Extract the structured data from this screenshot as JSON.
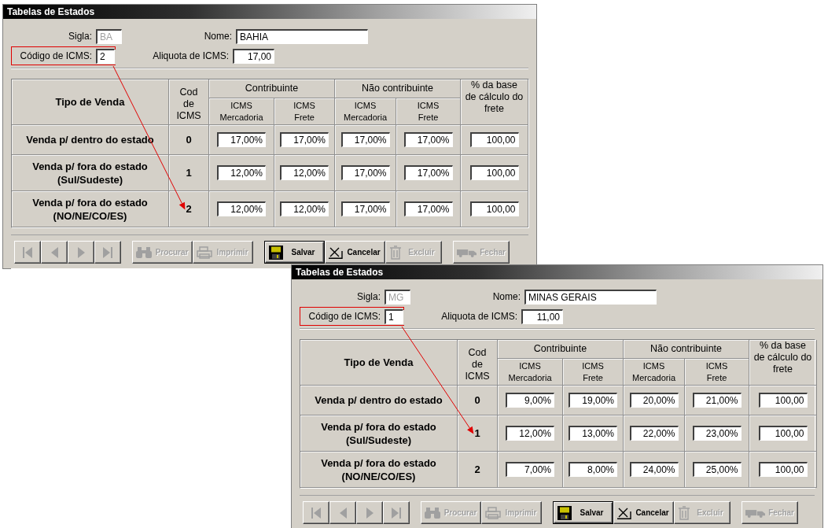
{
  "windows": [
    {
      "title": "Tabelas de Estados",
      "fields": {
        "sigla": {
          "label": "Sigla:",
          "value": "BA",
          "disabled": true
        },
        "nome": {
          "label": "Nome:",
          "value": "BAHIA"
        },
        "codigo": {
          "label": "Código de ICMS:",
          "value": "2",
          "highlighted": true
        },
        "aliquota": {
          "label": "Aliquota de ICMS:",
          "value": "17,00"
        }
      },
      "table": {
        "columns": [
          {
            "label": "Tipo de Venda"
          },
          {
            "label": "Cod de ICMS"
          },
          {
            "label": "Contribuinte",
            "sub": [
              "ICMS Mercadoria",
              "ICMS Frete"
            ]
          },
          {
            "label": "Não contribuinte",
            "sub": [
              "ICMS Mercadoria",
              "ICMS Frete"
            ]
          },
          {
            "label": "% da base de cálculo do frete"
          }
        ],
        "rows": [
          {
            "tipo": "Venda p/ dentro do estado",
            "cod": "0",
            "values": [
              "17,00%",
              "17,00%",
              "17,00%",
              "17,00%",
              "100,00"
            ],
            "pointed": false
          },
          {
            "tipo": "Venda p/ fora do estado (Sul/Sudeste)",
            "cod": "1",
            "values": [
              "12,00%",
              "12,00%",
              "17,00%",
              "17,00%",
              "100,00"
            ],
            "pointed": false
          },
          {
            "tipo": "Venda p/ fora do estado (NO/NE/CO/ES)",
            "cod": "2",
            "values": [
              "12,00%",
              "12,00%",
              "17,00%",
              "17,00%",
              "100,00"
            ],
            "pointed": true
          }
        ]
      },
      "toolbar": [
        {
          "buttons": [
            {
              "kind": "first",
              "disabled": true
            },
            {
              "kind": "prev",
              "disabled": true
            },
            {
              "kind": "next",
              "disabled": true
            },
            {
              "kind": "last",
              "disabled": true
            }
          ]
        },
        {
          "buttons": [
            {
              "kind": "search",
              "label": "Procurar",
              "disabled": true
            },
            {
              "kind": "print",
              "label": "Imprimir",
              "disabled": true
            }
          ]
        },
        {
          "buttons": [
            {
              "kind": "save",
              "label": "Salvar",
              "disabled": false,
              "default": true
            },
            {
              "kind": "cancel",
              "label": "Cancelar",
              "disabled": false,
              "default": false
            },
            {
              "kind": "delete",
              "label": "Excluir",
              "disabled": true
            }
          ]
        },
        {
          "buttons": [
            {
              "kind": "close",
              "label": "Fechar",
              "disabled": true
            }
          ]
        }
      ]
    },
    {
      "title": "Tabelas de Estados",
      "fields": {
        "sigla": {
          "label": "Sigla:",
          "value": "MG",
          "disabled": true
        },
        "nome": {
          "label": "Nome:",
          "value": "MINAS GERAIS"
        },
        "codigo": {
          "label": "Código de ICMS:",
          "value": "1",
          "highlighted": true
        },
        "aliquota": {
          "label": "Aliquota de ICMS:",
          "value": "11,00"
        }
      },
      "table": {
        "columns": [
          {
            "label": "Tipo de Venda"
          },
          {
            "label": "Cod de ICMS"
          },
          {
            "label": "Contribuinte",
            "sub": [
              "ICMS Mercadoria",
              "ICMS Frete"
            ]
          },
          {
            "label": "Não contribuinte",
            "sub": [
              "ICMS Mercadoria",
              "ICMS Frete"
            ]
          },
          {
            "label": "% da base de cálculo do frete"
          }
        ],
        "rows": [
          {
            "tipo": "Venda p/ dentro do estado",
            "cod": "0",
            "values": [
              "9,00%",
              "19,00%",
              "20,00%",
              "21,00%",
              "100,00"
            ],
            "pointed": false
          },
          {
            "tipo": "Venda p/ fora do estado (Sul/Sudeste)",
            "cod": "1",
            "values": [
              "12,00%",
              "13,00%",
              "22,00%",
              "23,00%",
              "100,00"
            ],
            "pointed": true
          },
          {
            "tipo": "Venda p/ fora do estado (NO/NE/CO/ES)",
            "cod": "2",
            "values": [
              "7,00%",
              "8,00%",
              "24,00%",
              "25,00%",
              "100,00"
            ],
            "pointed": false
          }
        ]
      },
      "toolbar": [
        {
          "buttons": [
            {
              "kind": "first",
              "disabled": true
            },
            {
              "kind": "prev",
              "disabled": true
            },
            {
              "kind": "next",
              "disabled": true
            },
            {
              "kind": "last",
              "disabled": true
            }
          ]
        },
        {
          "buttons": [
            {
              "kind": "search",
              "label": "Procurar",
              "disabled": true
            },
            {
              "kind": "print",
              "label": "Imprimir",
              "disabled": true
            }
          ]
        },
        {
          "buttons": [
            {
              "kind": "save",
              "label": "Salvar",
              "disabled": false,
              "default": true
            },
            {
              "kind": "cancel",
              "label": "Cancelar",
              "disabled": false,
              "default": false
            },
            {
              "kind": "delete",
              "label": "Excluir",
              "disabled": true
            }
          ]
        },
        {
          "buttons": [
            {
              "kind": "close",
              "label": "Fechar",
              "disabled": true
            }
          ]
        }
      ]
    }
  ]
}
